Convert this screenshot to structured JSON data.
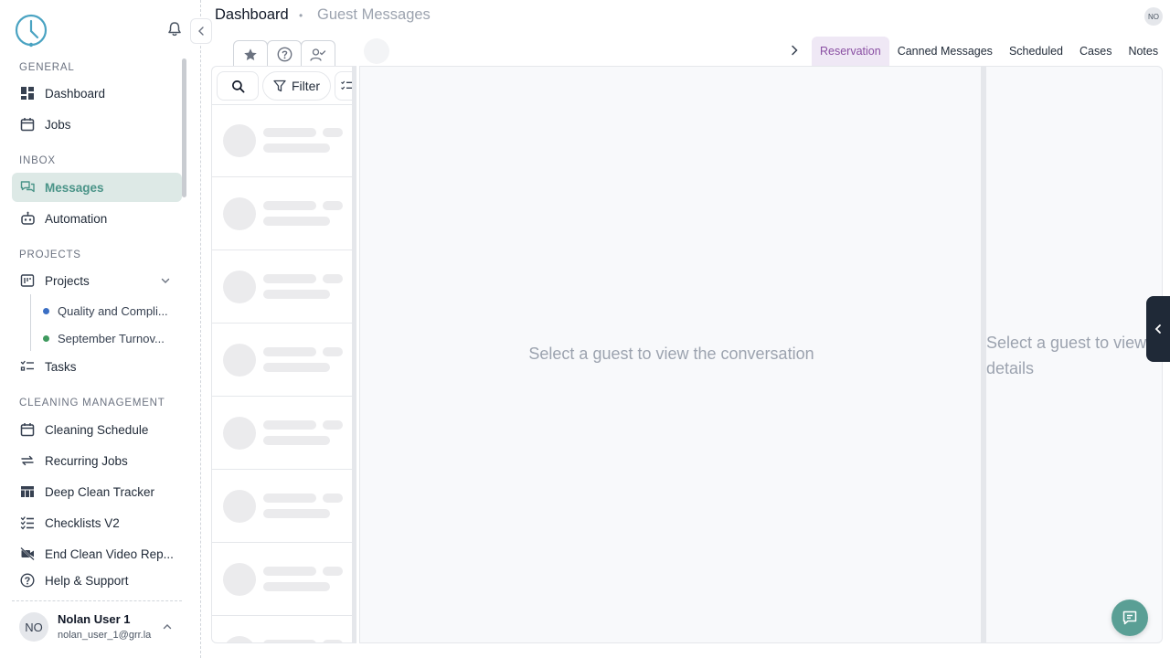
{
  "sidebar": {
    "sections": {
      "general": "GENERAL",
      "inbox": "INBOX",
      "projects": "PROJECTS",
      "cleaning": "CLEANING MANAGEMENT"
    },
    "items": {
      "dashboard": "Dashboard",
      "jobs": "Jobs",
      "messages": "Messages",
      "automation": "Automation",
      "projects": "Projects",
      "tasks": "Tasks",
      "cleaning_schedule": "Cleaning Schedule",
      "recurring_jobs": "Recurring Jobs",
      "deep_clean_tracker": "Deep Clean Tracker",
      "checklists_v2": "Checklists V2",
      "end_clean_video": "End Clean Video Rep...",
      "help_support": "Help & Support"
    },
    "sub_projects": [
      {
        "label": "Quality and Compli...",
        "color": "#3b6fc4"
      },
      {
        "label": "September Turnov...",
        "color": "#3f9a5f"
      }
    ],
    "user": {
      "initials": "NO",
      "name": "Nolan User 1",
      "email": "nolan_user_1@grr.la"
    }
  },
  "header": {
    "breadcrumb_home": "Dashboard",
    "breadcrumb_sep": "•",
    "breadcrumb_page": "Guest Messages",
    "avatar_initials": "NO"
  },
  "tabs": {
    "reservation": "Reservation",
    "canned_messages": "Canned Messages",
    "scheduled": "Scheduled",
    "cases": "Cases",
    "notes": "Notes"
  },
  "list": {
    "filter_label": "Filter"
  },
  "conversation": {
    "empty_text": "Select a guest to view the conversation"
  },
  "details": {
    "empty_text": "Select a guest to view details"
  },
  "colors": {
    "accent": "#4a9488",
    "active_bg": "#dde9e6",
    "tab_active": "#8a4fa3",
    "fab": "#5a9f95"
  }
}
